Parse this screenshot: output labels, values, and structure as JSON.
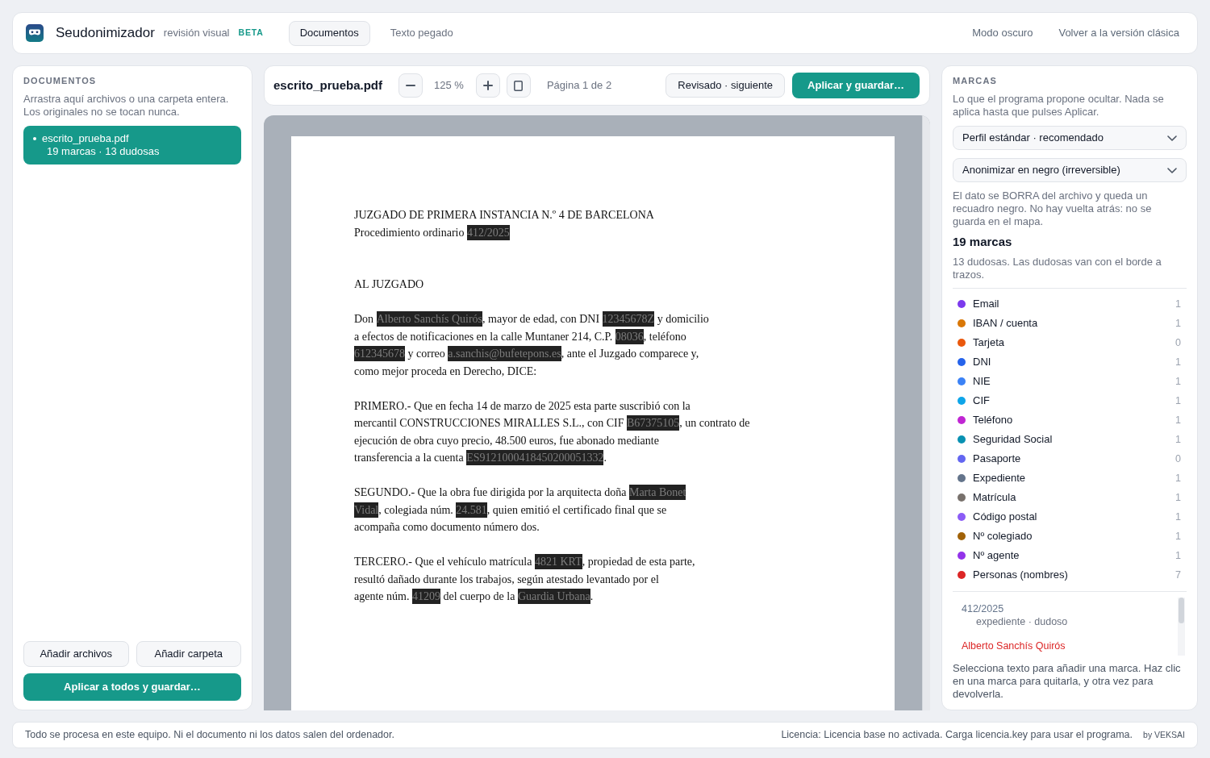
{
  "header": {
    "app_name": "Seudonimizador",
    "subtitle": "revisión visual",
    "badge": "BETA",
    "tabs": [
      {
        "label": "Documentos",
        "selected": true
      },
      {
        "label": "Texto pegado",
        "selected": false
      }
    ],
    "links": [
      "Modo oscuro",
      "Volver a la versión clásica"
    ]
  },
  "documents_panel": {
    "title": "DOCUMENTOS",
    "hint": "Arrastra aquí archivos o una carpeta entera. Los originales no se tocan nunca.",
    "files": [
      {
        "name": "escrito_prueba.pdf",
        "summary": "19 marcas · 13 dudosas",
        "selected": true
      }
    ],
    "buttons": [
      "Añadir archivos",
      "Añadir carpeta"
    ],
    "primary_button": "Aplicar a todos y guardar…"
  },
  "viewer": {
    "file_name": "escrito_prueba.pdf",
    "zoom": "125 %",
    "page": "Página 1 de 2",
    "buttons": [
      {
        "label": "Revisado · siguiente",
        "kind": "secondary"
      },
      {
        "label": "Aplicar y guardar…",
        "kind": "primary"
      }
    ],
    "paragraphs": [
      {
        "kind": "header",
        "lines": [
          [
            {
              "text": "JUZGADO DE PRIMERA INSTANCIA N.º 4 DE BARCELONA",
              "redacted": false
            }
          ],
          [
            {
              "text": "Procedimiento ordinario ",
              "redacted": false
            },
            {
              "text": "412/2025",
              "redacted": true
            }
          ]
        ]
      },
      {
        "kind": "body",
        "lines": [
          [
            {
              "text": "AL JUZGADO",
              "redacted": false
            }
          ]
        ]
      },
      {
        "kind": "body",
        "lines": [
          [
            {
              "text": "Don ",
              "redacted": false
            },
            {
              "text": "Alberto Sanchís Quirós",
              "redacted": true
            },
            {
              "text": ", mayor de edad, con DNI ",
              "redacted": false
            },
            {
              "text": "12345678Z",
              "redacted": true
            },
            {
              "text": " y domicilio",
              "redacted": false
            }
          ],
          [
            {
              "text": "a efectos de notificaciones en la calle Muntaner 214, C.P. ",
              "redacted": false
            },
            {
              "text": "08036",
              "redacted": true
            },
            {
              "text": ", teléfono",
              "redacted": false
            }
          ],
          [
            {
              "text": "612345678",
              "redacted": true
            },
            {
              "text": " y correo ",
              "redacted": false
            },
            {
              "text": "a.sanchis@bufetepons.es",
              "redacted": true
            },
            {
              "text": ", ante el Juzgado comparece y,",
              "redacted": false
            }
          ],
          [
            {
              "text": "como mejor proceda en Derecho, DICE:",
              "redacted": false
            }
          ]
        ]
      },
      {
        "kind": "body",
        "lines": [
          [
            {
              "text": "PRIMERO.- Que en fecha 14 de marzo de 2025 esta parte suscribió con la",
              "redacted": false
            }
          ],
          [
            {
              "text": "mercantil CONSTRUCCIONES MIRALLES S.L., con CIF ",
              "redacted": false
            },
            {
              "text": "B67375105",
              "redacted": true
            },
            {
              "text": ", un contrato de",
              "redacted": false
            }
          ],
          [
            {
              "text": "ejecución de obra cuyo precio, 48.500 euros, fue abonado mediante",
              "redacted": false
            }
          ],
          [
            {
              "text": "transferencia a la cuenta ",
              "redacted": false
            },
            {
              "text": "ES9121000418450200051332",
              "redacted": true
            },
            {
              "text": ".",
              "redacted": false
            }
          ]
        ]
      },
      {
        "kind": "body",
        "lines": [
          [
            {
              "text": "SEGUNDO.- Que la obra fue dirigida por la arquitecta doña ",
              "redacted": false
            },
            {
              "text": "Marta Bonet",
              "redacted": true
            }
          ],
          [
            {
              "text": "Vidal",
              "redacted": true
            },
            {
              "text": ", colegiada núm. ",
              "redacted": false
            },
            {
              "text": "24.581",
              "redacted": true
            },
            {
              "text": ", quien emitió el certificado final que se",
              "redacted": false
            }
          ],
          [
            {
              "text": "acompaña como documento número dos.",
              "redacted": false
            }
          ]
        ]
      },
      {
        "kind": "body",
        "lines": [
          [
            {
              "text": "TERCERO.- Que el vehículo matrícula ",
              "redacted": false
            },
            {
              "text": "4821 KRT",
              "redacted": true
            },
            {
              "text": ", propiedad de esta parte,",
              "redacted": false
            }
          ],
          [
            {
              "text": "resultó dañado durante los trabajos, según atestado levantado por el",
              "redacted": false
            }
          ],
          [
            {
              "text": "agente núm. ",
              "redacted": false
            },
            {
              "text": "41209",
              "redacted": true
            },
            {
              "text": " del cuerpo de la ",
              "redacted": false
            },
            {
              "text": "Guardia Urbana",
              "redacted": true
            },
            {
              "text": ".",
              "redacted": false
            }
          ]
        ]
      }
    ]
  },
  "marks_panel": {
    "title": "MARCAS",
    "hint": "Lo que el programa propone ocultar. Nada se aplica hasta que pulses Aplicar.",
    "selects": [
      "Perfil estándar · recomendado",
      "Anonimizar en negro (irreversible)"
    ],
    "warning": "El dato se BORRA del archivo y queda un recuadro negro. No hay vuelta atrás: no se guarda en el mapa.",
    "count_title": "19 marcas",
    "count_note": "13 dudosas. Las dudosas van con el borde a trazos.",
    "categories": [
      {
        "label": "Email",
        "count": "1",
        "color": "#7c3aed"
      },
      {
        "label": "IBAN / cuenta",
        "count": "1",
        "color": "#d97706"
      },
      {
        "label": "Tarjeta",
        "count": "0",
        "color": "#ea580c"
      },
      {
        "label": "DNI",
        "count": "1",
        "color": "#2563eb"
      },
      {
        "label": "NIE",
        "count": "1",
        "color": "#3b82f6"
      },
      {
        "label": "CIF",
        "count": "1",
        "color": "#0ea5e9"
      },
      {
        "label": "Teléfono",
        "count": "1",
        "color": "#c026d3"
      },
      {
        "label": "Seguridad Social",
        "count": "1",
        "color": "#0891b2"
      },
      {
        "label": "Pasaporte",
        "count": "0",
        "color": "#6366f1"
      },
      {
        "label": "Expediente",
        "count": "1",
        "color": "#64748b"
      },
      {
        "label": "Matrícula",
        "count": "1",
        "color": "#78716c"
      },
      {
        "label": "Código postal",
        "count": "1",
        "color": "#8b5cf6"
      },
      {
        "label": "Nº colegiado",
        "count": "1",
        "color": "#a16207"
      },
      {
        "label": "Nº agente",
        "count": "1",
        "color": "#9333ea"
      },
      {
        "label": "Personas (nombres)",
        "count": "7",
        "color": "#dc2626"
      }
    ],
    "entries": [
      {
        "value": "412/2025",
        "detail": "expediente · dudoso",
        "color": "#64748b"
      },
      {
        "value": "Alberto Sanchís Quirós",
        "color": "#dc2626"
      }
    ],
    "help": "Selecciona texto para añadir una marca. Haz clic en una marca para quitarla, y otra vez para devolverla."
  },
  "status_bar": {
    "left": "Todo se procesa en este equipo. Ni el documento ni los datos salen del ordenador.",
    "license": "Licencia: Licencia base no activada. Carga licencia.key para usar el programa.",
    "brand": "by VEKSAI"
  }
}
